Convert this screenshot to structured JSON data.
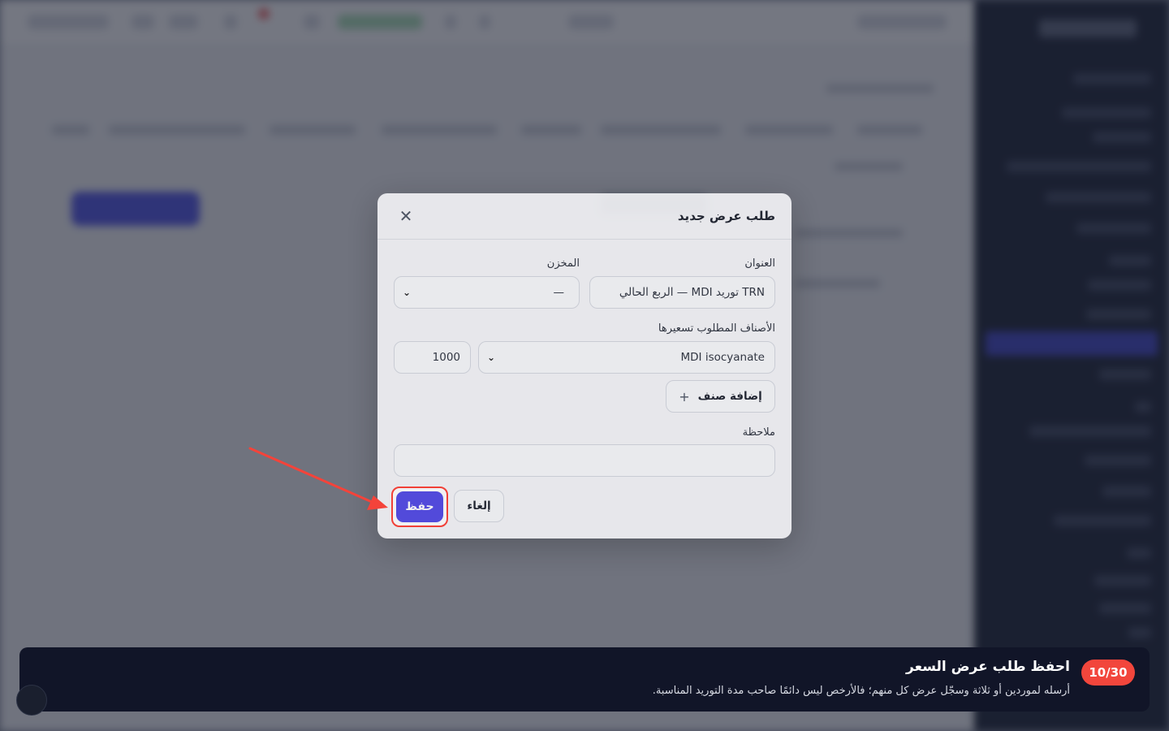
{
  "modal": {
    "title": "طلب عرض جديد",
    "title_label": "العنوان",
    "title_value": "TRN توريد MDI — الربع الحالي",
    "warehouse_label": "المخزن",
    "warehouse_value": "—",
    "items_label": "الأصناف المطلوب تسعيرها",
    "item_product": "MDI isocyanate",
    "item_quantity": "1000",
    "add_item_label": "إضافة صنف",
    "note_label": "ملاحظة",
    "note_value": "",
    "cancel_label": "إلغاء",
    "save_label": "حفظ"
  },
  "tour": {
    "step": "10/30",
    "title": "احفظ طلب عرض السعر",
    "description": "أرسله لموردين أو ثلاثة وسجّل عرض كل منهم؛ فالأرخص ليس دائمًا صاحب مدة التوريد المناسبة."
  },
  "colors": {
    "accent": "#4f46e5",
    "highlight": "#ff3b30",
    "banner": "#111528",
    "badge": "#f2463c"
  },
  "icons": [
    "close-icon",
    "chevron-down-icon",
    "plus-icon",
    "arrow-annotation-icon"
  ]
}
